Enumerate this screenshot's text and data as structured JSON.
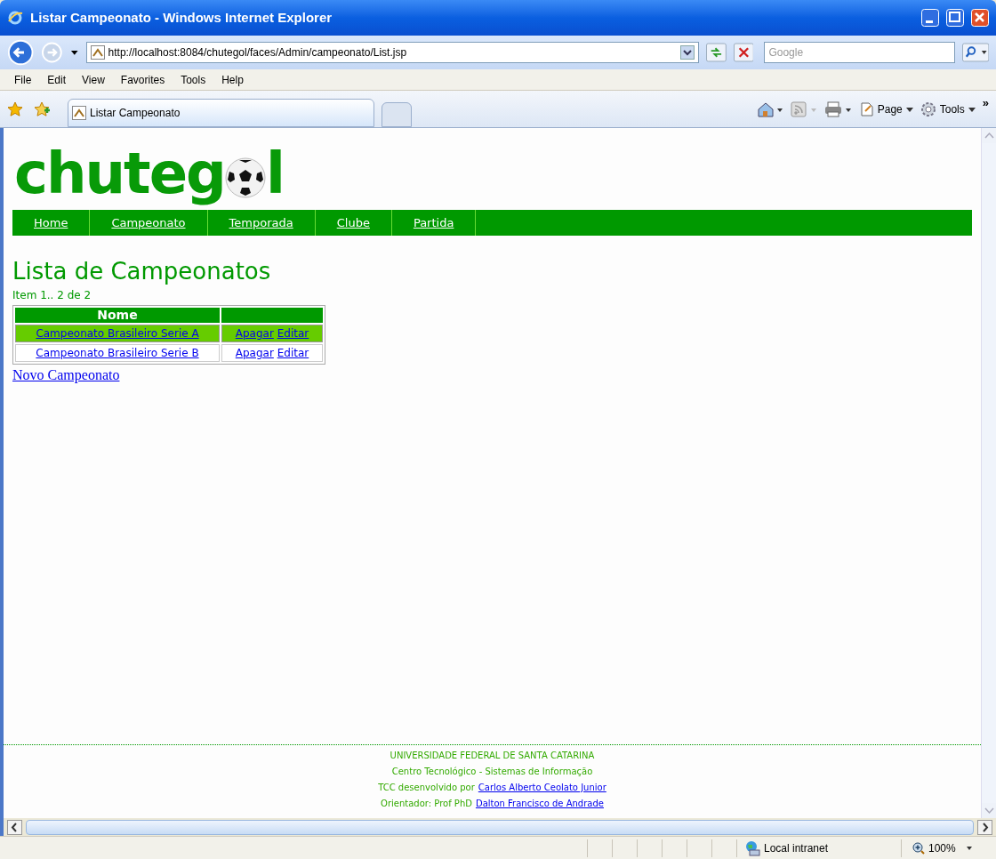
{
  "window": {
    "title": "Listar Campeonato - Windows Internet Explorer"
  },
  "address_bar": {
    "url": "http://localhost:8084/chutegol/faces/Admin/campeonato/List.jsp"
  },
  "search": {
    "placeholder": "Google"
  },
  "menu": [
    "File",
    "Edit",
    "View",
    "Favorites",
    "Tools",
    "Help"
  ],
  "tabs": [
    {
      "label": "Listar Campeonato",
      "selected": true
    }
  ],
  "command_bar": {
    "page": "Page",
    "tools": "Tools",
    "more": "»"
  },
  "logo": {
    "before_ball": "chuteg",
    "after_ball": "l"
  },
  "nav": [
    "Home",
    "Campeonato",
    "Temporada",
    "Clube",
    "Partida"
  ],
  "heading": "Lista de Campeonatos",
  "item_count": "Item 1.. 2 de 2",
  "table": {
    "columns": [
      "Nome"
    ],
    "rows": [
      {
        "name": "Campeonato Brasileiro Serie A",
        "actions": [
          "Apagar",
          "Editar"
        ],
        "highlighted": true
      },
      {
        "name": "Campeonato Brasileiro Serie B",
        "actions": [
          "Apagar",
          "Editar"
        ],
        "highlighted": false
      }
    ]
  },
  "new_link": "Novo Campeonato",
  "footer": [
    {
      "text": "UNIVERSIDADE FEDERAL DE SANTA CATARINA"
    },
    {
      "text": "Centro Tecnológico - Sistemas de Informação"
    },
    {
      "text": "TCC desenvolvido por",
      "link": "Carlos Alberto Ceolato Junior"
    },
    {
      "text": "Orientador: Prof PhD",
      "link": "Dalton Francisco de Andrade"
    }
  ],
  "status_bar": {
    "zone": "Local intranet",
    "zoom": "100%"
  }
}
